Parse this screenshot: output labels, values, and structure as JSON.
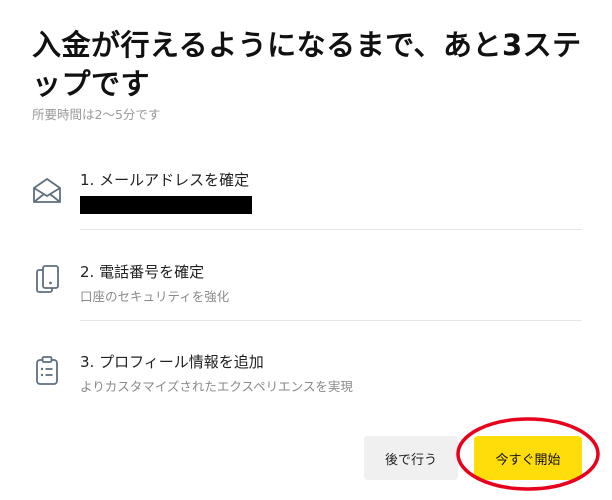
{
  "dialog": {
    "title": "入金が行えるようになるまで、あと3ステップです",
    "subtitle": "所要時間は2〜5分です"
  },
  "steps": [
    {
      "icon": "envelope-icon",
      "label": "1. メールアドレスを確定",
      "description": ""
    },
    {
      "icon": "phone-check-icon",
      "label": "2. 電話番号を確定",
      "description": "口座のセキュリティを強化"
    },
    {
      "icon": "clipboard-icon",
      "label": "3. プロフィール情報を追加",
      "description": "よりカスタマイズされたエクスペリエンスを実現"
    }
  ],
  "buttons": {
    "later_label": "後で行う",
    "start_label": "今すぐ開始"
  },
  "colors": {
    "accent": "#ffdd0a",
    "highlight_ring": "#e8001c",
    "icon": "#5f6f7f",
    "secondary_button": "#f0f0f0"
  }
}
